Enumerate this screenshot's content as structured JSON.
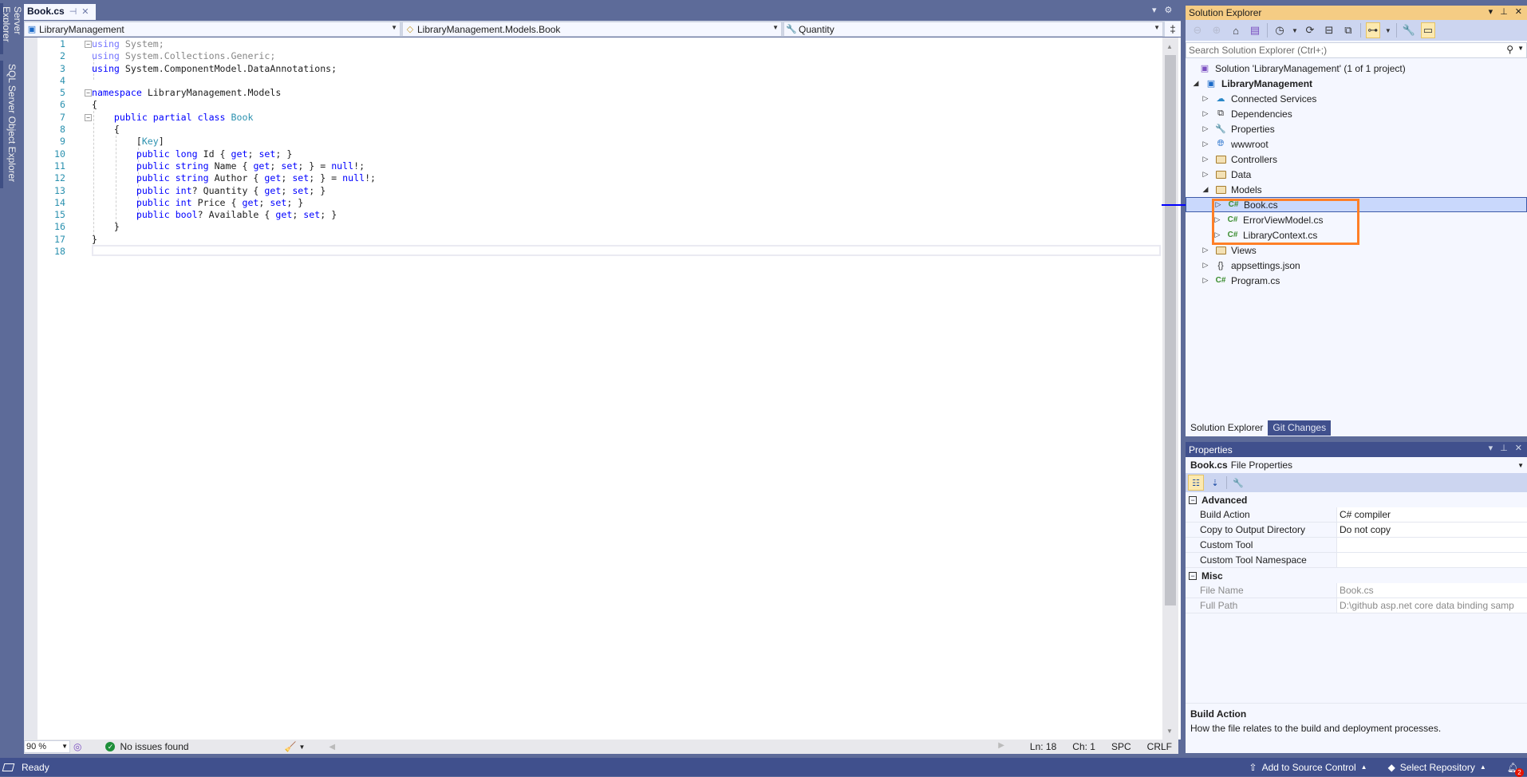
{
  "left_strip": {
    "tabs": [
      "Server Explorer",
      "SQL Server Object Explorer"
    ]
  },
  "document_tab": {
    "title": "Book.cs",
    "pin_icon": "pin-icon",
    "close_icon": "close-icon"
  },
  "navbar": {
    "project": "LibraryManagement",
    "type": "LibraryManagement.Models.Book",
    "member": "Quantity"
  },
  "editor": {
    "lines": [
      {
        "n": "1",
        "tokens": [
          {
            "t": "using ",
            "c": "kw dim"
          },
          {
            "t": "System;",
            "c": "dim"
          }
        ],
        "fold": "−"
      },
      {
        "n": "2",
        "tokens": [
          {
            "t": "using ",
            "c": "kw dim"
          },
          {
            "t": "System.Collections.Generic;",
            "c": "dim"
          }
        ]
      },
      {
        "n": "3",
        "tokens": [
          {
            "t": "using ",
            "c": "kw"
          },
          {
            "t": "System.ComponentModel.DataAnnotations;",
            "c": ""
          }
        ]
      },
      {
        "n": "4",
        "tokens": []
      },
      {
        "n": "5",
        "tokens": [
          {
            "t": "namespace ",
            "c": "kw"
          },
          {
            "t": "LibraryManagement.Models",
            "c": ""
          }
        ],
        "fold": "−"
      },
      {
        "n": "6",
        "tokens": [
          {
            "t": "{",
            "c": ""
          }
        ]
      },
      {
        "n": "7",
        "tokens": [
          {
            "t": "    public partial class ",
            "c": "kw"
          },
          {
            "t": "Book",
            "c": "ty"
          }
        ],
        "fold": "−"
      },
      {
        "n": "8",
        "tokens": [
          {
            "t": "    {",
            "c": ""
          }
        ]
      },
      {
        "n": "9",
        "tokens": [
          {
            "t": "        [",
            "c": ""
          },
          {
            "t": "Key",
            "c": "ty"
          },
          {
            "t": "]",
            "c": ""
          }
        ]
      },
      {
        "n": "10",
        "tokens": [
          {
            "t": "        public long ",
            "c": "kw"
          },
          {
            "t": "Id { ",
            "c": ""
          },
          {
            "t": "get",
            "c": "kw"
          },
          {
            "t": "; ",
            "c": ""
          },
          {
            "t": "set",
            "c": "kw"
          },
          {
            "t": "; }",
            "c": ""
          }
        ]
      },
      {
        "n": "11",
        "tokens": [
          {
            "t": "        public string ",
            "c": "kw"
          },
          {
            "t": "Name { ",
            "c": ""
          },
          {
            "t": "get",
            "c": "kw"
          },
          {
            "t": "; ",
            "c": ""
          },
          {
            "t": "set",
            "c": "kw"
          },
          {
            "t": "; } = ",
            "c": ""
          },
          {
            "t": "null",
            "c": "kw"
          },
          {
            "t": "!;",
            "c": ""
          }
        ]
      },
      {
        "n": "12",
        "tokens": [
          {
            "t": "        public string ",
            "c": "kw"
          },
          {
            "t": "Author { ",
            "c": ""
          },
          {
            "t": "get",
            "c": "kw"
          },
          {
            "t": "; ",
            "c": ""
          },
          {
            "t": "set",
            "c": "kw"
          },
          {
            "t": "; } = ",
            "c": ""
          },
          {
            "t": "null",
            "c": "kw"
          },
          {
            "t": "!;",
            "c": ""
          }
        ]
      },
      {
        "n": "13",
        "tokens": [
          {
            "t": "        public int",
            "c": "kw"
          },
          {
            "t": "? Quantity { ",
            "c": ""
          },
          {
            "t": "get",
            "c": "kw"
          },
          {
            "t": "; ",
            "c": ""
          },
          {
            "t": "set",
            "c": "kw"
          },
          {
            "t": "; }",
            "c": ""
          }
        ]
      },
      {
        "n": "14",
        "tokens": [
          {
            "t": "        public int ",
            "c": "kw"
          },
          {
            "t": "Price { ",
            "c": ""
          },
          {
            "t": "get",
            "c": "kw"
          },
          {
            "t": "; ",
            "c": ""
          },
          {
            "t": "set",
            "c": "kw"
          },
          {
            "t": "; }",
            "c": ""
          }
        ]
      },
      {
        "n": "15",
        "tokens": [
          {
            "t": "        public bool",
            "c": "kw"
          },
          {
            "t": "? Available { ",
            "c": ""
          },
          {
            "t": "get",
            "c": "kw"
          },
          {
            "t": "; ",
            "c": ""
          },
          {
            "t": "set",
            "c": "kw"
          },
          {
            "t": "; }",
            "c": ""
          }
        ]
      },
      {
        "n": "16",
        "tokens": [
          {
            "t": "    }",
            "c": ""
          }
        ]
      },
      {
        "n": "17",
        "tokens": [
          {
            "t": "}",
            "c": ""
          }
        ]
      },
      {
        "n": "18",
        "tokens": []
      }
    ]
  },
  "editor_status": {
    "zoom": "90 %",
    "issues": "No issues found",
    "line": "Ln: 18",
    "col": "Ch: 1",
    "whitespace": "SPC",
    "line_ending": "CRLF"
  },
  "statusbar": {
    "ready": "Ready",
    "add_to_source_control": "Add to Source Control",
    "select_repository": "Select Repository",
    "notifications_count": "2"
  },
  "solution_explorer": {
    "title": "Solution Explorer",
    "search_placeholder": "Search Solution Explorer (Ctrl+;)",
    "tree": [
      {
        "label": "Solution 'LibraryManagement' (1 of 1 project)",
        "level": 0,
        "expander": "",
        "icon": "solution-icon"
      },
      {
        "label": "LibraryManagement",
        "level": 0,
        "expander": "◢",
        "icon": "web-project-icon",
        "bold": true
      },
      {
        "label": "Connected Services",
        "level": 1,
        "expander": "▷",
        "icon": "connected-services-icon"
      },
      {
        "label": "Dependencies",
        "level": 1,
        "expander": "▷",
        "icon": "dependencies-icon"
      },
      {
        "label": "Properties",
        "level": 1,
        "expander": "▷",
        "icon": "properties-icon"
      },
      {
        "label": "wwwroot",
        "level": 1,
        "expander": "▷",
        "icon": "globe-icon"
      },
      {
        "label": "Controllers",
        "level": 1,
        "expander": "▷",
        "icon": "folder-icon"
      },
      {
        "label": "Data",
        "level": 1,
        "expander": "▷",
        "icon": "folder-icon"
      },
      {
        "label": "Models",
        "level": 1,
        "expander": "◢",
        "icon": "folder-open-icon"
      },
      {
        "label": "Book.cs",
        "level": 2,
        "expander": "▷",
        "icon": "csharp-file-icon",
        "selected": true
      },
      {
        "label": "ErrorViewModel.cs",
        "level": 2,
        "expander": "▷",
        "icon": "csharp-file-icon"
      },
      {
        "label": "LibraryContext.cs",
        "level": 2,
        "expander": "▷",
        "icon": "csharp-file-icon"
      },
      {
        "label": "Views",
        "level": 1,
        "expander": "▷",
        "icon": "folder-icon"
      },
      {
        "label": "appsettings.json",
        "level": 1,
        "expander": "▷",
        "icon": "json-file-icon"
      },
      {
        "label": "Program.cs",
        "level": 1,
        "expander": "▷",
        "icon": "csharp-file-icon"
      }
    ],
    "bottom_tabs": [
      "Solution Explorer",
      "Git Changes"
    ]
  },
  "properties": {
    "title": "Properties",
    "object_name": "Book.cs",
    "object_type": "File Properties",
    "categories": [
      {
        "name": "Advanced",
        "rows": [
          {
            "name": "Build Action",
            "value": "C# compiler"
          },
          {
            "name": "Copy to Output Directory",
            "value": "Do not copy"
          },
          {
            "name": "Custom Tool",
            "value": ""
          },
          {
            "name": "Custom Tool Namespace",
            "value": ""
          }
        ]
      },
      {
        "name": "Misc",
        "rows": [
          {
            "name": "File Name",
            "value": "Book.cs",
            "readonly": true
          },
          {
            "name": "Full Path",
            "value": "D:\\github asp.net core data binding samp",
            "readonly": true
          }
        ]
      }
    ],
    "description_title": "Build Action",
    "description_text": "How the file relates to the build and deployment processes."
  },
  "colors": {
    "chrome": "#5d6b99",
    "statusbar": "#40508d",
    "active_panel_header": "#f5cc84",
    "highlight_box": "#ff7f27",
    "keyword": "#0000ff",
    "type": "#2b91af"
  }
}
